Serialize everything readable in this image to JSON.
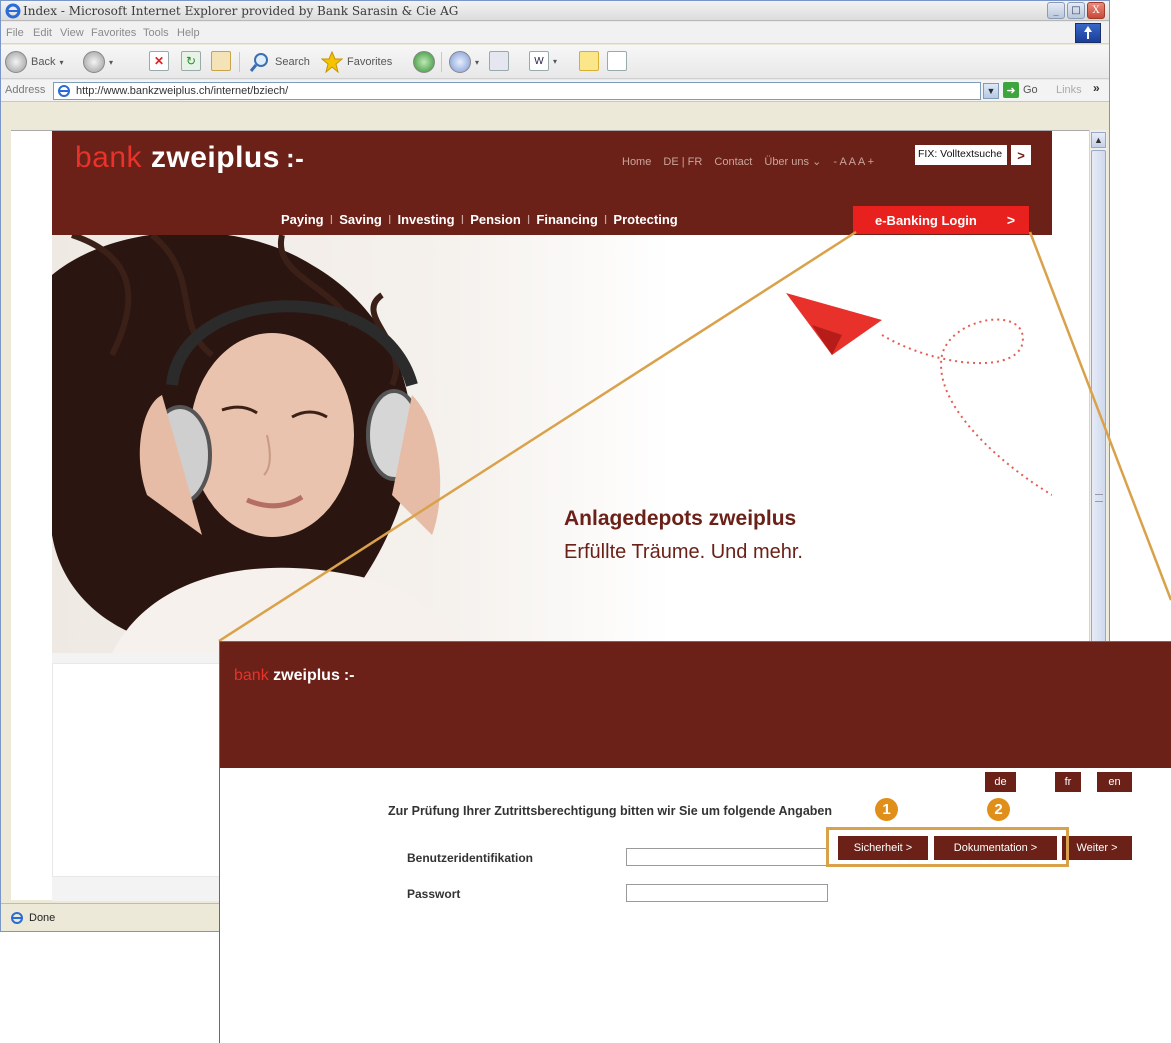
{
  "window": {
    "title": "Index - Microsoft Internet Explorer provided by Bank Sarasin & Cie AG",
    "controls": [
      "_",
      "□",
      "X"
    ]
  },
  "menu": [
    "File",
    "Edit",
    "View",
    "Favorites",
    "Tools",
    "Help"
  ],
  "toolbar": {
    "back": "Back",
    "search": "Search",
    "favorites": "Favorites"
  },
  "address": {
    "label": "Address",
    "url": "http://www.bankzweiplus.ch/internet/bziech/",
    "go": "Go",
    "links": "Links",
    "links_chevron": "»"
  },
  "status": {
    "text": "Done"
  },
  "site": {
    "brand_bank": "bank",
    "brand_zweiplus": "zweiplus",
    "brand_mark": ":-",
    "topnav": [
      "Home",
      "DE | FR",
      "Contact",
      "Über uns ⌄",
      "- A A A +"
    ],
    "search_value": "FIX: Volltextsuche",
    "search_go": ">",
    "mainnav": [
      "Paying",
      "Saving",
      "Investing",
      "Pension",
      "Financing",
      "Protecting"
    ],
    "nav_separator": "I",
    "ebanking_label": "e-Banking Login",
    "ebanking_arrow": ">",
    "hero_title": "Anlagedepots zweiplus",
    "hero_subtitle": "Erfüllte Träume. Und mehr."
  },
  "login": {
    "brand_bank": "bank",
    "brand_zweiplus": "zweiplus",
    "brand_mark": ":-",
    "languages": [
      "de",
      "fr",
      "en"
    ],
    "heading": "Zur Prüfung Ihrer Zutrittsberechtigung bitten wir Sie um folgende Angaben",
    "user_label": "Benutzeridentifikation",
    "user_value": "",
    "password_label": "Passwort",
    "password_value": "",
    "buttons": {
      "security": "Sicherheit >",
      "documentation": "Dokumentation >",
      "next": "Weiter >"
    },
    "badges": [
      "1",
      "2"
    ]
  },
  "colors": {
    "brand": "#6b2118",
    "accent": "#e9211e",
    "highlight": "#d9a24a",
    "badge": "#e0901a"
  }
}
